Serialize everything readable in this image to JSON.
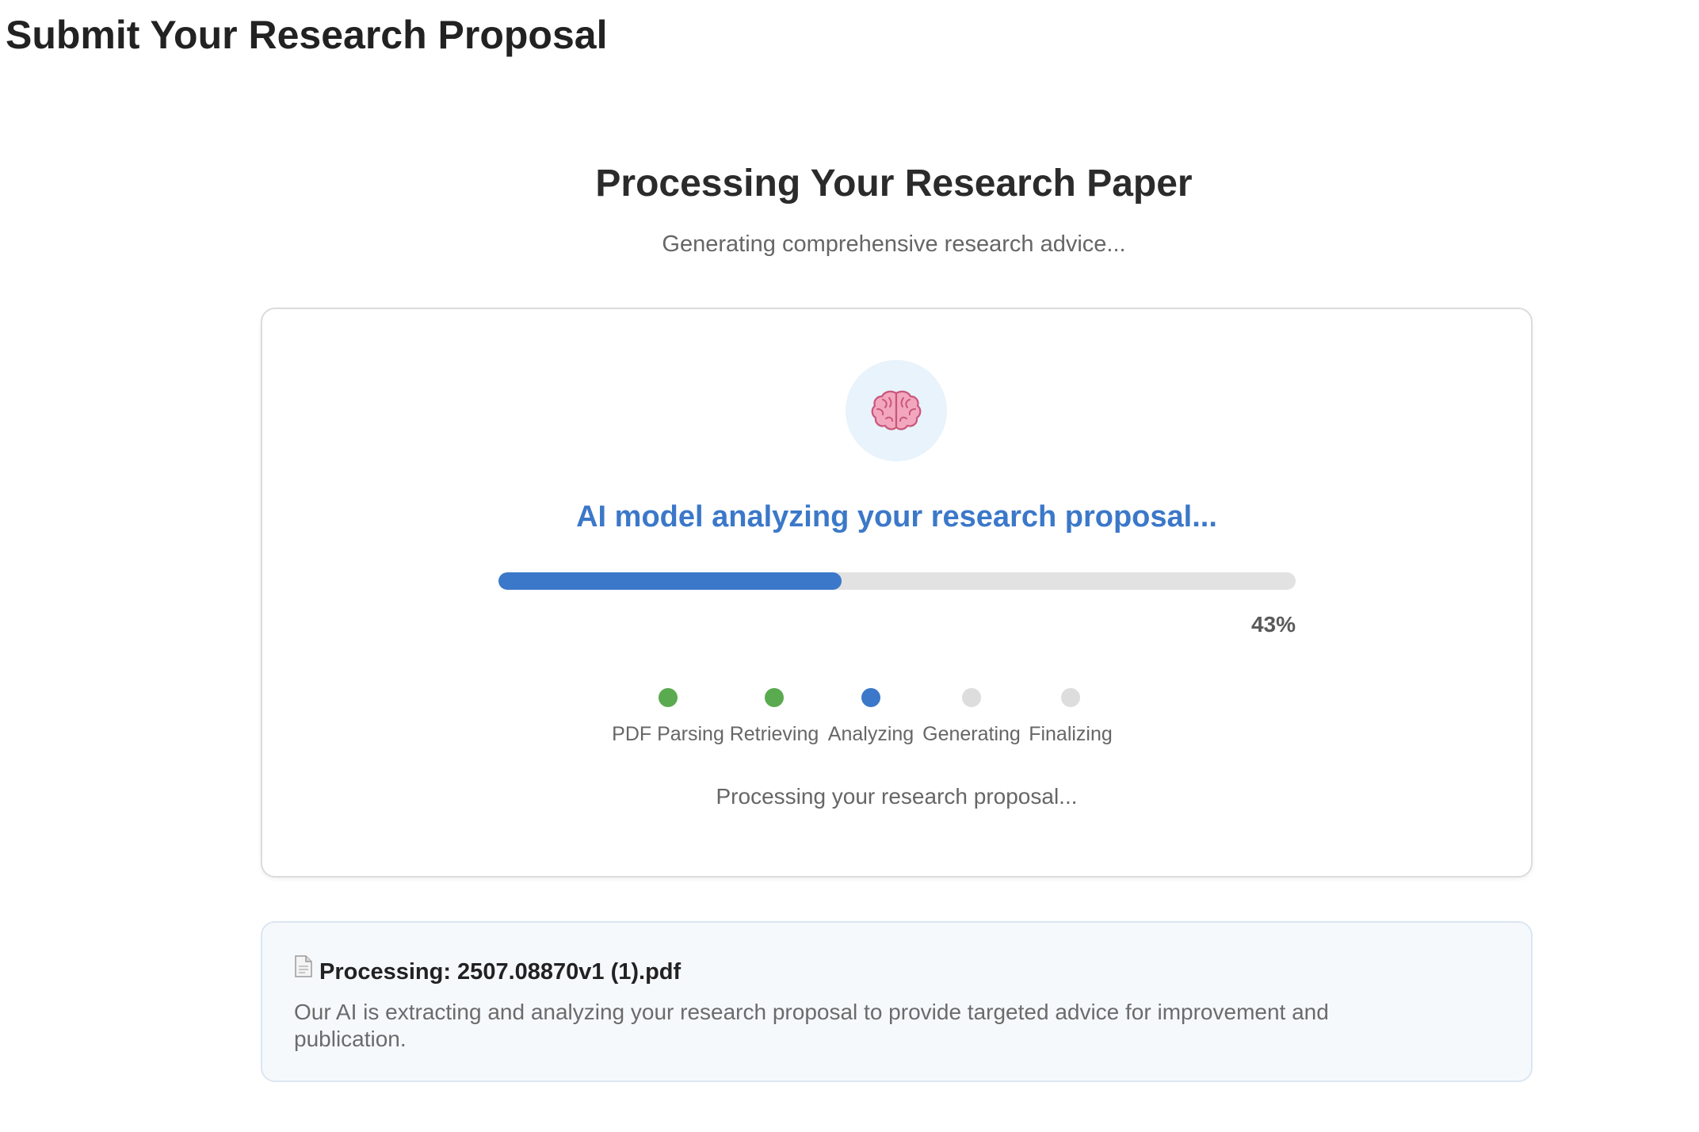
{
  "header": {
    "title": "Submit Your Research Proposal"
  },
  "processing": {
    "title": "Processing Your Research Paper",
    "subtitle": "Generating comprehensive research advice..."
  },
  "card": {
    "icon": "brain-icon",
    "status_heading": "AI model analyzing your research proposal...",
    "progress_fraction": 0.43,
    "progress_label": "43%",
    "steps": [
      {
        "label": "PDF Parsing",
        "state": "done"
      },
      {
        "label": "Retrieving",
        "state": "done"
      },
      {
        "label": "Analyzing",
        "state": "active"
      },
      {
        "label": "Generating",
        "state": "pending"
      },
      {
        "label": "Finalizing",
        "state": "pending"
      }
    ],
    "status_message": "Processing your research proposal..."
  },
  "info": {
    "icon": "document-icon",
    "title": "Processing: 2507.08870v1 (1).pdf",
    "description": "Our AI is extracting and analyzing your research proposal to provide targeted advice for improvement and publication."
  },
  "colors": {
    "accent": "#3b78c9",
    "done": "#5aaa4f",
    "pending": "#dddddd",
    "brain_bg": "#e8f3fc",
    "info_bg": "#f6f9fc"
  }
}
